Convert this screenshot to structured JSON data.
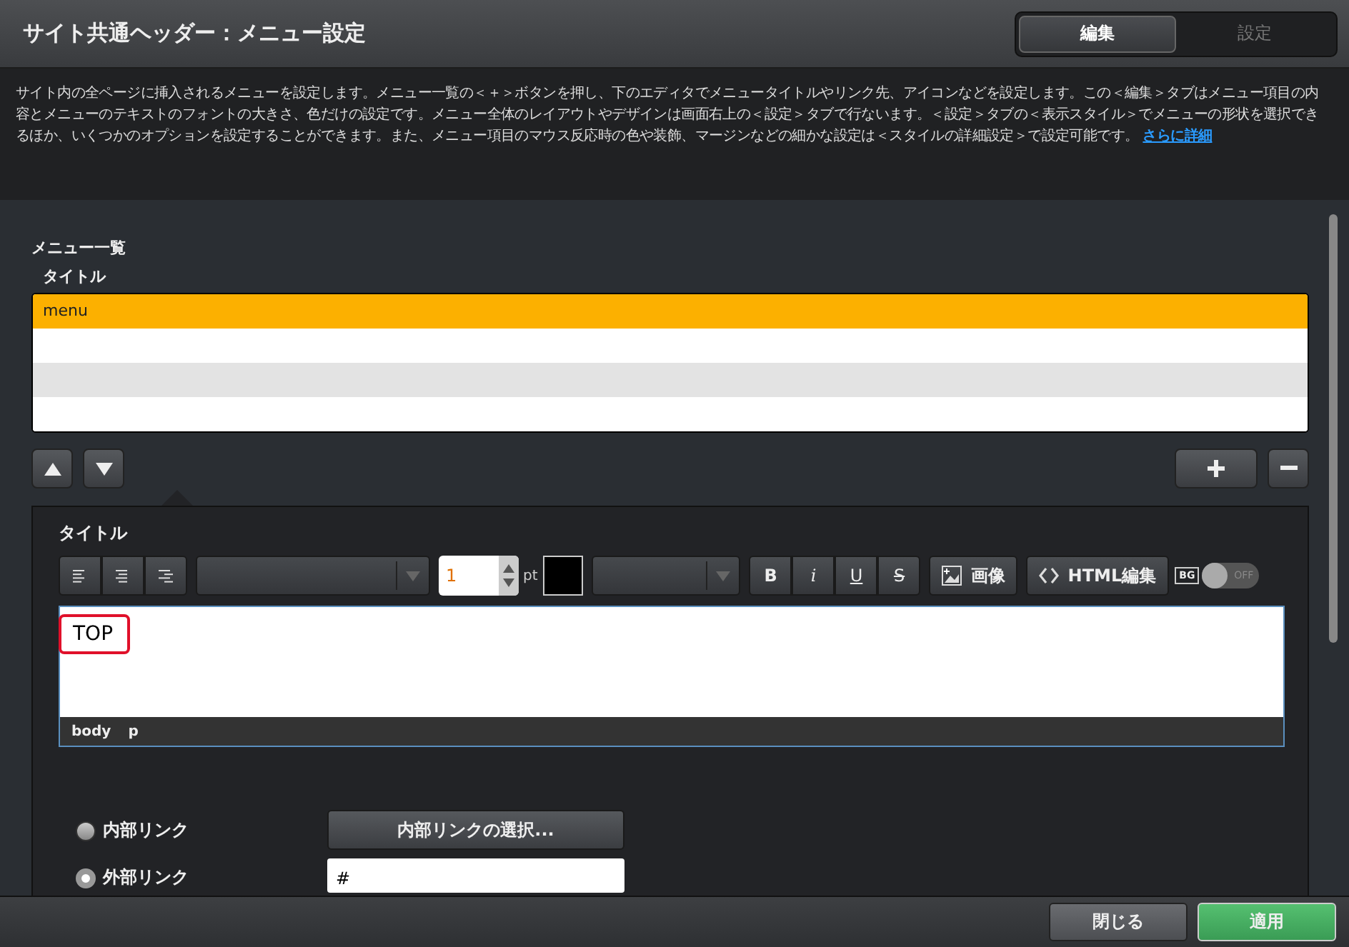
{
  "header": {
    "title": "サイト共通ヘッダー：メニュー設定",
    "tabs": [
      {
        "label": "編集",
        "selected": true
      },
      {
        "label": "設定",
        "selected": false
      }
    ]
  },
  "description": {
    "text": "サイト内の全ページに挿入されるメニューを設定します。メニュー一覧の＜＋＞ボタンを押し、下のエディタでメニュータイトルやリンク先、アイコンなどを設定します。この＜編集＞タブはメニュー項目の内容とメニューのテキストのフォントの大きさ、色だけの設定です。メニュー全体のレイアウトやデザインは画面右上の＜設定＞タブで行ないます。＜設定＞タブの＜表示スタイル＞でメニューの形状を選択できるほか、いくつかのオプションを設定することができます。また、メニュー項目のマウス反応時の色や装飾、マージンなどの細かな設定は＜スタイルの詳細設定＞で設定可能です。",
    "link": "さらに詳細"
  },
  "menu_list": {
    "heading": "メニュー一覧",
    "column": "タイトル",
    "rows": [
      {
        "title": "menu",
        "selected": true
      }
    ]
  },
  "editor": {
    "label": "タイトル",
    "font_size": "1",
    "unit": "pt",
    "format_buttons": [
      {
        "label": "B",
        "kind": "bold"
      },
      {
        "label": "i",
        "kind": "italic"
      },
      {
        "label": "U",
        "kind": "underline"
      },
      {
        "label": "S",
        "kind": "strike"
      }
    ],
    "image_button": "画像",
    "html_button": "HTML編集",
    "bg_toggle": {
      "label": "BG",
      "on": false,
      "state_label": "OFF"
    },
    "content": "TOP",
    "path": [
      "body",
      "p"
    ]
  },
  "link": {
    "options": [
      {
        "label": "内部リンク",
        "selected": false
      },
      {
        "label": "外部リンク",
        "selected": true
      }
    ],
    "internal_button": "内部リンクの選択...",
    "url": "#"
  },
  "footer": {
    "buttons": [
      {
        "label": "閉じる",
        "kind": "secondary"
      },
      {
        "label": "適用",
        "kind": "primary"
      }
    ]
  }
}
